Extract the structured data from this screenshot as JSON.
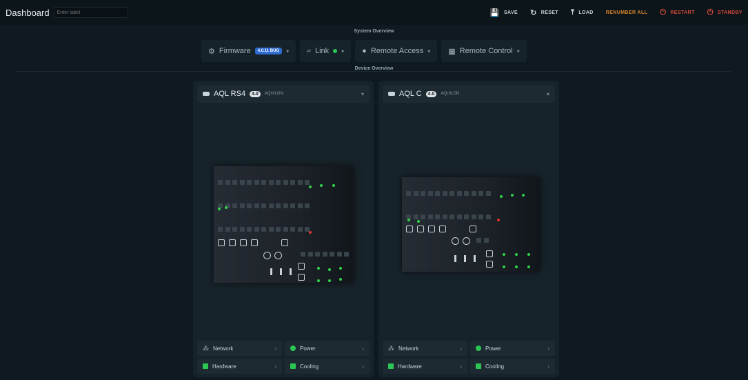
{
  "header": {
    "title": "Dashboard",
    "label_placeholder": "Enter label",
    "actions": [
      {
        "name": "save-button",
        "icon": "save-icon",
        "glyph": "💾",
        "label": "SAVE",
        "style": "normal"
      },
      {
        "name": "reset-button",
        "icon": "reset-icon",
        "glyph": "↻",
        "label": "RESET",
        "style": "normal"
      },
      {
        "name": "load-button",
        "icon": "upload-icon",
        "glyph": "⤒",
        "label": "LOAD",
        "style": "normal"
      },
      {
        "name": "renumber-all-button",
        "icon": "",
        "glyph": "",
        "label": "RENUMBER ALL",
        "style": "warn"
      },
      {
        "name": "restart-button",
        "icon": "power-icon",
        "glyph": "⏻",
        "label": "RESTART",
        "style": "danger"
      },
      {
        "name": "standby-button",
        "icon": "power-icon",
        "glyph": "⏻",
        "label": "STANDBY",
        "style": "danger"
      }
    ]
  },
  "system_overview": {
    "title": "System Overview",
    "firmware": {
      "label": "Firmware",
      "badge": "4.0.11 BUG"
    },
    "link": {
      "label": "Link"
    },
    "remote_access": {
      "label": "Remote Access"
    },
    "remote_control": {
      "label": "Remote Control"
    }
  },
  "device_overview": {
    "title": "Device Overview"
  },
  "devices": [
    {
      "name": "AQL RS4",
      "version": "4.0",
      "id": "AQUILON"
    },
    {
      "name": "AQL C",
      "version": "4.0",
      "id": "AQUILON"
    }
  ],
  "status_buttons": {
    "network": "Network",
    "power": "Power",
    "hardware": "Hardware",
    "cooling": "Cooling"
  },
  "colors": {
    "accent_blue": "#2f6bd1",
    "ok_green": "#2cc655",
    "warn_orange": "#d9842a",
    "danger_red": "#d84a3a"
  }
}
